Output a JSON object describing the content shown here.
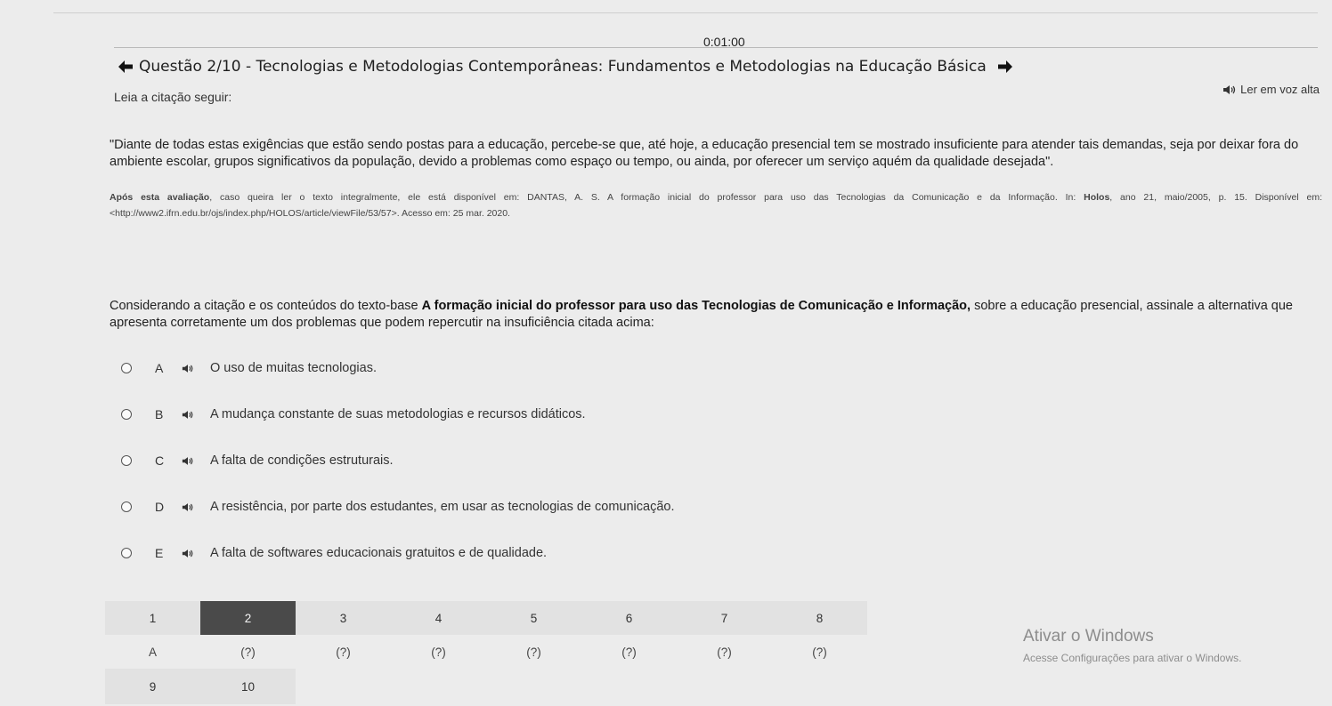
{
  "timer": "0:01:00",
  "header": {
    "title": "Questão 2/10 - Tecnologias e Metodologias Contemporâneas: Fundamentos e Metodologias na Educação Básica"
  },
  "instruction": "Leia a citação  seguir:",
  "tts_label": "Ler em voz alta",
  "quote": "\"Diante de todas estas exigências que estão sendo postas para a educação, percebe-se que, até hoje, a educação presencial tem se mostrado insuficiente para atender tais demandas, seja por deixar fora do ambiente escolar, grupos significativos da população, devido a problemas como espaço ou tempo, ou ainda, por oferecer um serviço aquém da qualidade desejada\".",
  "reference": {
    "lead_bold": "Após esta avaliação",
    "text": ", caso queira ler o texto integralmente, ele está disponível em: DANTAS, A. S. A formação inicial do professor para uso das Tecnologias da Comunicação e da Informação. In: ",
    "journal_bold": "Holos",
    "tail": ", ano 21, maio/2005, p. 15. Disponível em: <http://www2.ifrn.edu.br/ojs/index.php/HOLOS/article/viewFile/53/57>. Acesso em: 25 mar. 2020."
  },
  "prompt": {
    "pre": "Considerando a citação e os conteúdos do texto-base ",
    "bold": "A formação inicial do professor para uso das Tecnologias de Comunicação e Informação,",
    "post": " sobre a educação presencial, assinale a alternativa que apresenta corretamente um dos problemas que podem repercutir na insuficiência citada acima:"
  },
  "options": [
    {
      "letter": "A",
      "text": "O uso de muitas tecnologias."
    },
    {
      "letter": "B",
      "text": "A mudança constante de suas metodologias e recursos didáticos."
    },
    {
      "letter": "C",
      "text": "A falta de condições estruturais."
    },
    {
      "letter": "D",
      "text": "A resistência, por parte dos estudantes, em usar as tecnologias de comunicação."
    },
    {
      "letter": "E",
      "text": "A falta de softwares educacionais gratuitos e de qualidade."
    }
  ],
  "nav": {
    "numbers": [
      "1",
      "2",
      "3",
      "4",
      "5",
      "6",
      "7",
      "8"
    ],
    "answers": [
      "A",
      "(?)",
      "(?)",
      "(?)",
      "(?)",
      "(?)",
      "(?)",
      "(?)"
    ],
    "numbers2": [
      "9",
      "10"
    ],
    "current": "2"
  },
  "watermark": {
    "title": "Ativar o Windows",
    "subtitle": "Acesse Configurações para ativar o Windows."
  }
}
